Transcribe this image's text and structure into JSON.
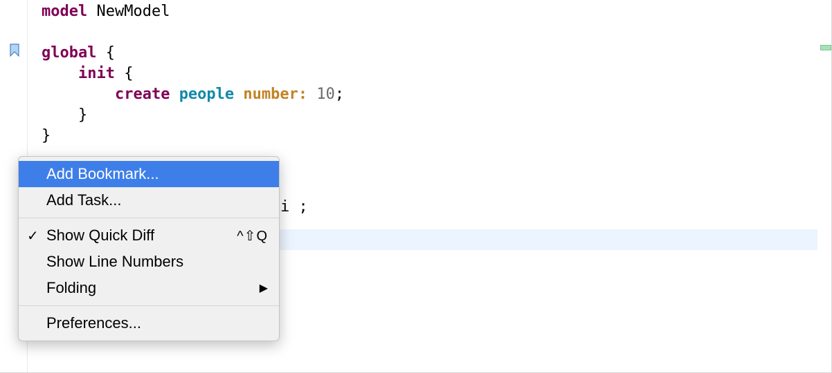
{
  "code": {
    "line1": {
      "model": "model",
      "name": "NewModel"
    },
    "line3": {
      "global": "global",
      "brace": " {"
    },
    "line4": {
      "init": "init",
      "brace": " {"
    },
    "line5": {
      "create": "create ",
      "people": "people",
      "number": " number:",
      "val": " 10",
      "semi": ";"
    },
    "line6": "    }",
    "line7": "}",
    "stub": "i ;"
  },
  "menu": {
    "addBookmark": "Add Bookmark...",
    "addTask": "Add Task...",
    "showQuickDiff": "Show Quick Diff",
    "showQuickDiffShortcut": "^⇧Q",
    "showLineNumbers": "Show Line Numbers",
    "folding": "Folding",
    "preferences": "Preferences...",
    "checkmark": "✓",
    "submenuArrow": "▶"
  }
}
